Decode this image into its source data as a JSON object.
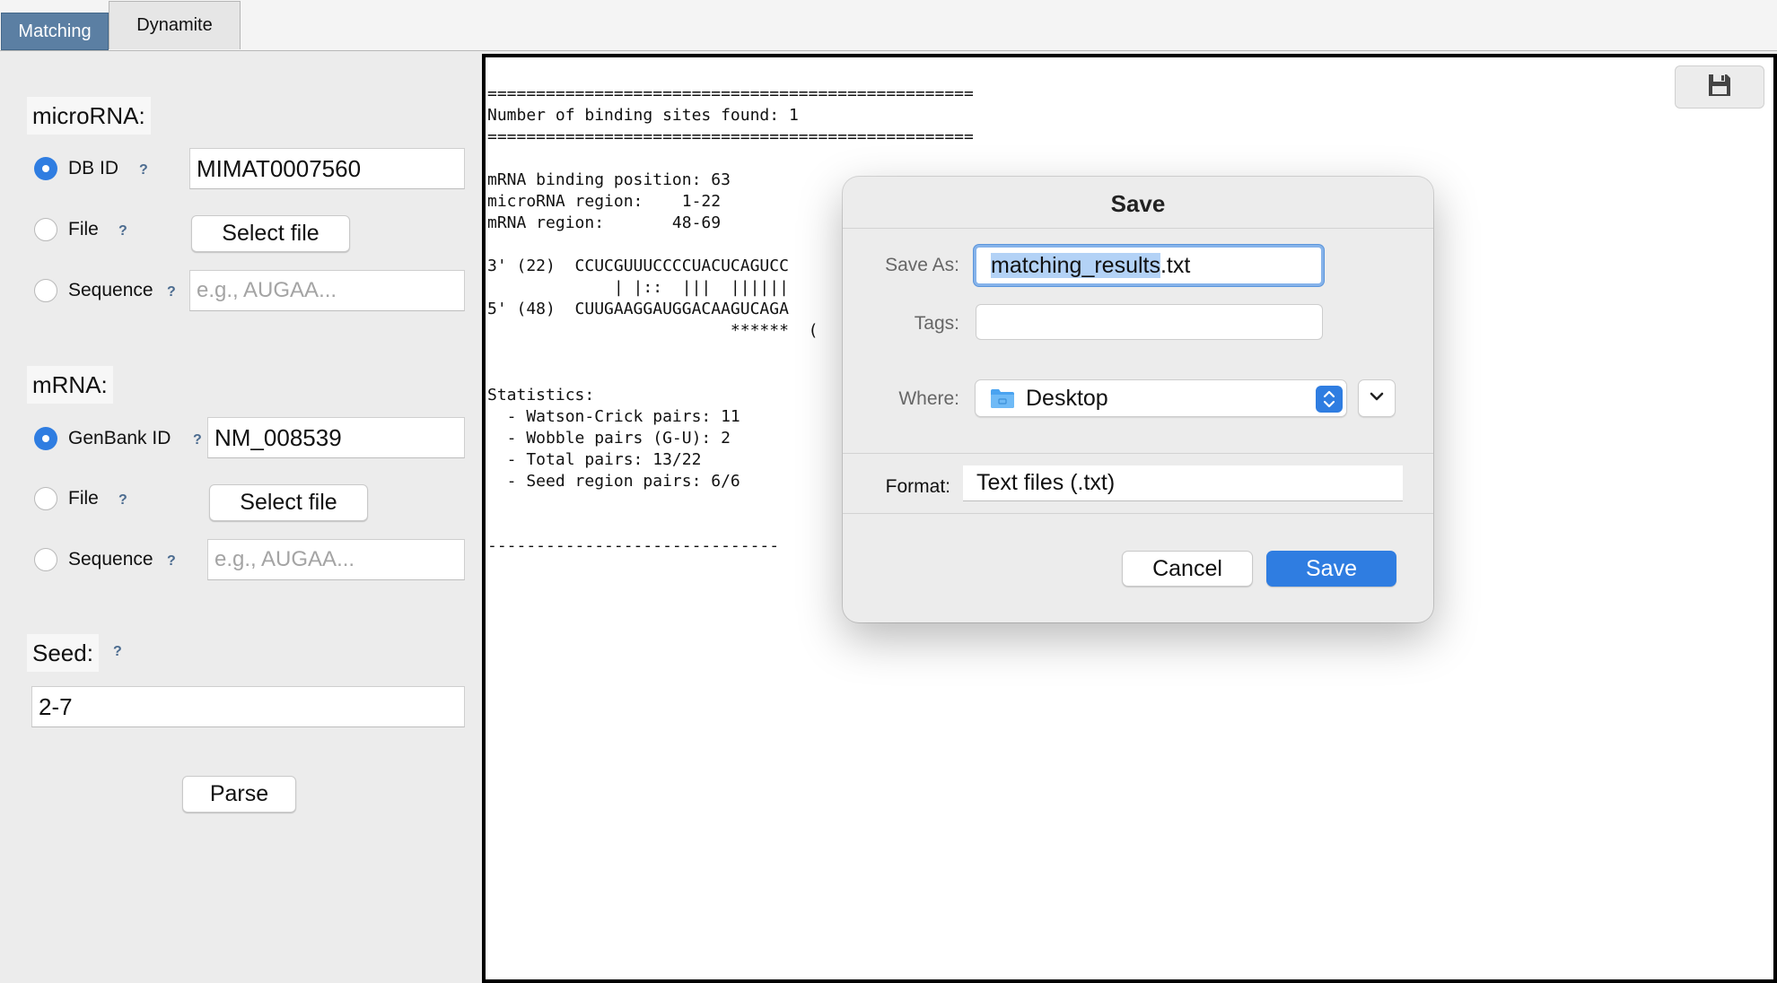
{
  "tabs": [
    {
      "label": "Matching",
      "active": true
    },
    {
      "label": "Dynamite",
      "active": false
    }
  ],
  "microrna": {
    "title": "microRNA:",
    "db_id_label": "DB ID",
    "db_id_value": "MIMAT0007560",
    "file_label": "File",
    "select_file_label": "Select file",
    "sequence_label": "Sequence",
    "sequence_placeholder": "e.g., AUGAA...",
    "selected": "db_id"
  },
  "mrna": {
    "title": "mRNA:",
    "genbank_label": "GenBank ID",
    "genbank_value": "NM_008539",
    "file_label": "File",
    "select_file_label": "Select file",
    "sequence_label": "Sequence",
    "sequence_placeholder": "e.g., AUGAA...",
    "selected": "genbank_id"
  },
  "help_glyph": "?",
  "seed": {
    "title": "Seed:",
    "value": "2-7"
  },
  "parse_label": "Parse",
  "output_text": "==================================================\nNumber of binding sites found: 1\n==================================================\n\nmRNA binding position: 63\nmicroRNA region:    1-22\nmRNA region:       48-69\n\n3' (22)  CCUCGUUUCCCCUACUCAGUCC\n             | |::  |||  ||||||\n5' (48)  CUUGAAGGAUGGACAAGUCAGA\n                         ******  (\n\n\nStatistics:\n  - Watson-Crick pairs: 11\n  - Wobble pairs (G-U): 2\n  - Total pairs: 13/22\n  - Seed region pairs: 6/6\n\n\n------------------------------",
  "save_dialog": {
    "title": "Save",
    "save_as_label": "Save As:",
    "filename_selected": "matching_results",
    "filename_ext": ".txt",
    "tags_label": "Tags:",
    "where_label": "Where:",
    "where_value": "Desktop",
    "format_label": "Format:",
    "format_value": "Text files (.txt)",
    "cancel_label": "Cancel",
    "save_label": "Save"
  },
  "icons": {
    "save_output": "floppy-disk-icon",
    "where_folder": "folder-icon",
    "where_stepper": "up-down-chevron-icon",
    "expand": "chevron-down-icon"
  },
  "colors": {
    "accent": "#2f7de1",
    "active_tab": "#5b7fa3",
    "help": "#4b6b8f",
    "selection": "#b3d2f6"
  }
}
